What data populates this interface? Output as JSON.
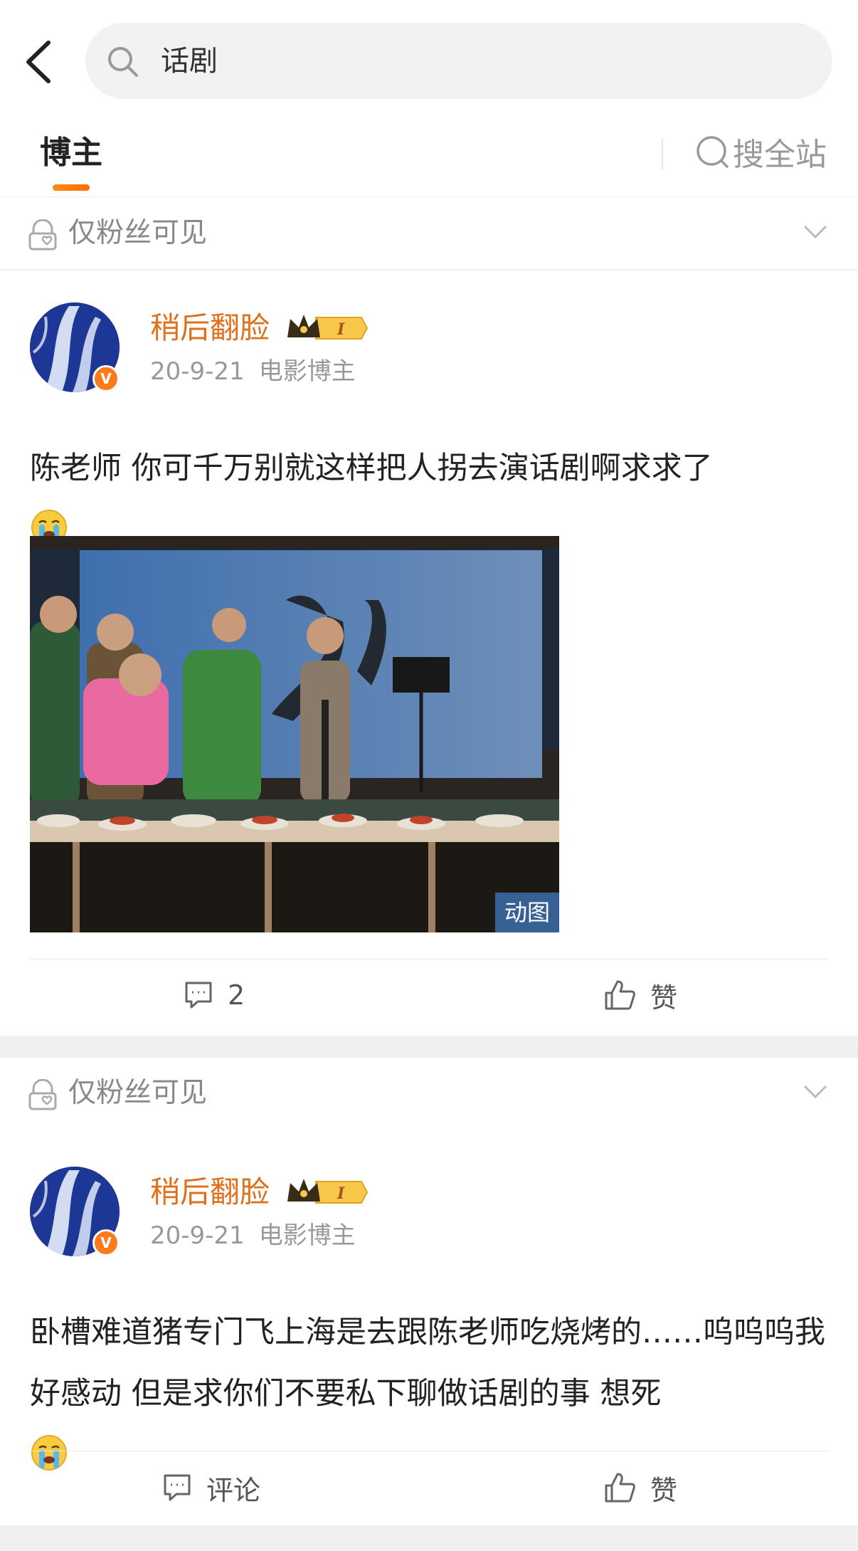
{
  "header": {
    "back_icon": "chevron-left-icon",
    "search_icon": "search-icon",
    "search_query": "话剧"
  },
  "tabs": {
    "active": "博主",
    "search_all": "搜全站",
    "accent": "#ff7a1a"
  },
  "posts": [
    {
      "visibility": "仅粉丝可见",
      "username": "稍后翻脸",
      "level_badge": "I",
      "date": "20-9-21",
      "role": "电影博主",
      "text": "陈老师 你可千万别就这样把人拐去演话剧啊求求了",
      "emoji": "crying-face-icon",
      "media_badge": "动图",
      "comment_count": "2",
      "like_label": "赞"
    },
    {
      "visibility": "仅粉丝可见",
      "username": "稍后翻脸",
      "level_badge": "I",
      "date": "20-9-21",
      "role": "电影博主",
      "text": "卧槽难道猪专门飞上海是去跟陈老师吃烧烤的……呜呜呜我好感动 但是求你们不要私下聊做话剧的事 想死",
      "emoji": "crying-face-icon",
      "comment_label": "评论",
      "like_label": "赞"
    }
  ],
  "colors": {
    "username": "#e0701c",
    "meta": "#999999",
    "badge_orange": "#ff7a1a"
  }
}
